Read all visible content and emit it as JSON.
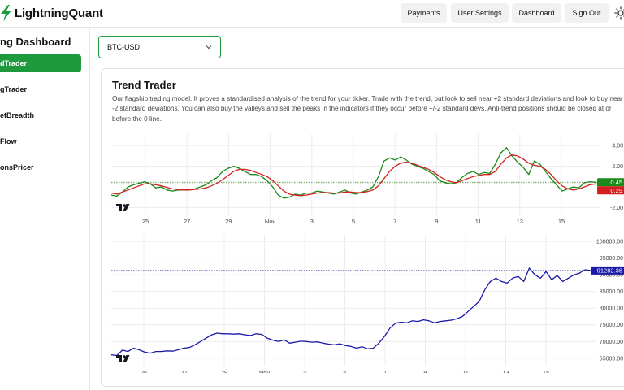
{
  "app": {
    "name": "LightningQuant"
  },
  "header": {
    "nav": [
      {
        "label": "Payments"
      },
      {
        "label": "User Settings"
      },
      {
        "label": "Dashboard"
      },
      {
        "label": "Sign Out"
      }
    ]
  },
  "sidebar": {
    "title": "ng Dashboard",
    "items": [
      {
        "label": "dTrader",
        "active": true
      },
      {
        "label": "gTrader",
        "active": false
      },
      {
        "label": "etBreadth",
        "active": false
      },
      {
        "label": "Flow",
        "active": false
      },
      {
        "label": "onsPricer",
        "active": false
      }
    ]
  },
  "ticker_select": {
    "value": "BTC-USD"
  },
  "card": {
    "title": "Trend Trader",
    "description": "Our flagship trading model. It proves a standardised analysis of the trend for your ticker. Trade with the trend, but look to sell near +2 standard deviations and look to buy near -2 standard deviations. You can also buy the valleys and sell the peaks in the indicators if they occur before +/-2 standard devs. Anti-trend positions should be closed at or before the 0 line."
  },
  "colors": {
    "accent": "#1e9a3c",
    "indicator_fast": "#1a8a1a",
    "indicator_slow": "#d42020",
    "price_line": "#1c1aa8"
  },
  "chart_data": [
    {
      "type": "line",
      "title": "",
      "x_tick_labels": [
        "25",
        "27",
        "29",
        "Nov",
        "3",
        "5",
        "7",
        "9",
        "11",
        "13",
        "15"
      ],
      "y_tick_labels": [
        "4.00",
        "2.00",
        "-2.00"
      ],
      "ylim": [
        -2.6,
        4.8
      ],
      "badges": [
        {
          "label": "0.45",
          "value": 0.45,
          "color": "#1a8a1a"
        },
        {
          "label": "0.29",
          "value": 0.29,
          "color": "#d42020"
        }
      ],
      "series": [
        {
          "name": "",
          "color": "#1a8a1a",
          "values": [
            -0.8,
            -0.9,
            -0.5,
            0.0,
            0.2,
            0.35,
            0.5,
            0.3,
            -0.1,
            0.0,
            -0.3,
            -0.4,
            -0.3,
            -0.3,
            -0.25,
            -0.2,
            0.0,
            0.2,
            0.6,
            0.9,
            1.5,
            1.8,
            2.0,
            1.8,
            1.5,
            1.2,
            1.2,
            1.0,
            0.6,
            0.0,
            -0.8,
            -1.1,
            -1.0,
            -0.7,
            -0.8,
            -0.6,
            -0.6,
            -0.4,
            -0.5,
            -0.6,
            -0.7,
            -0.5,
            -0.3,
            -0.6,
            -0.7,
            -0.5,
            -0.3,
            0.0,
            1.0,
            2.5,
            2.8,
            2.6,
            2.9,
            2.6,
            2.2,
            2.0,
            1.8,
            1.5,
            1.2,
            0.6,
            0.4,
            0.3,
            0.4,
            0.9,
            1.3,
            1.5,
            1.2,
            1.4,
            1.3,
            2.2,
            3.3,
            3.8,
            3.0,
            2.4,
            1.9,
            1.2,
            2.5,
            2.2,
            1.5,
            0.8,
            0.2,
            -0.4,
            -0.2,
            0.0,
            -0.1,
            0.4,
            0.5,
            0.45
          ]
        },
        {
          "name": "",
          "color": "#d42020",
          "values": [
            -0.6,
            -0.7,
            -0.5,
            -0.3,
            -0.1,
            0.1,
            0.3,
            0.3,
            0.2,
            0.1,
            -0.05,
            -0.2,
            -0.25,
            -0.3,
            -0.3,
            -0.25,
            -0.2,
            -0.1,
            0.1,
            0.35,
            0.7,
            1.1,
            1.5,
            1.7,
            1.7,
            1.6,
            1.4,
            1.2,
            1.0,
            0.6,
            0.1,
            -0.4,
            -0.7,
            -0.8,
            -0.85,
            -0.8,
            -0.7,
            -0.6,
            -0.55,
            -0.55,
            -0.6,
            -0.6,
            -0.5,
            -0.5,
            -0.55,
            -0.55,
            -0.45,
            -0.3,
            0.1,
            0.8,
            1.5,
            2.0,
            2.3,
            2.4,
            2.3,
            2.1,
            1.9,
            1.7,
            1.4,
            1.0,
            0.7,
            0.5,
            0.4,
            0.6,
            0.8,
            1.0,
            1.1,
            1.2,
            1.2,
            1.5,
            2.2,
            2.8,
            3.1,
            3.0,
            2.7,
            2.3,
            2.1,
            2.0,
            1.7,
            1.2,
            0.6,
            0.1,
            -0.2,
            -0.3,
            -0.2,
            0.0,
            0.2,
            0.29
          ]
        }
      ]
    },
    {
      "type": "line",
      "title": "",
      "x_tick_labels": [
        "26",
        "27",
        "29",
        "Nov",
        "3",
        "5",
        "7",
        "9",
        "11",
        "13",
        "15"
      ],
      "y_tick_labels": [
        "100000.00",
        "95000.00",
        "90000.00",
        "85000.00",
        "80000.00",
        "75000.00",
        "70000.00",
        "65000.00"
      ],
      "ylim": [
        63000,
        101000
      ],
      "badges": [
        {
          "label": "91282.38",
          "value": 91282.38,
          "color": "#1c1aa8"
        }
      ],
      "series": [
        {
          "name": "",
          "color": "#1c1aa8",
          "values": [
            66000,
            65800,
            67400,
            67000,
            68000,
            67500,
            66800,
            66500,
            67000,
            67000,
            67200,
            67100,
            67500,
            68000,
            68200,
            69000,
            70000,
            71000,
            72000,
            72500,
            72300,
            72300,
            72200,
            72300,
            72000,
            71800,
            72300,
            72100,
            71000,
            70400,
            70000,
            70500,
            69500,
            69800,
            70100,
            70000,
            69800,
            69900,
            69500,
            69200,
            69000,
            69300,
            68800,
            68500,
            68000,
            68400,
            67800,
            68000,
            69500,
            71500,
            74000,
            75500,
            75800,
            75600,
            76200,
            76000,
            76500,
            76200,
            75600,
            76000,
            76200,
            76400,
            76800,
            77500,
            79000,
            80500,
            82000,
            85500,
            88000,
            89000,
            88000,
            87500,
            89000,
            89500,
            88000,
            92000,
            90000,
            89000,
            91000,
            88500,
            89800,
            88000,
            89000,
            90000,
            90500,
            91500,
            91282.38
          ]
        }
      ]
    }
  ]
}
